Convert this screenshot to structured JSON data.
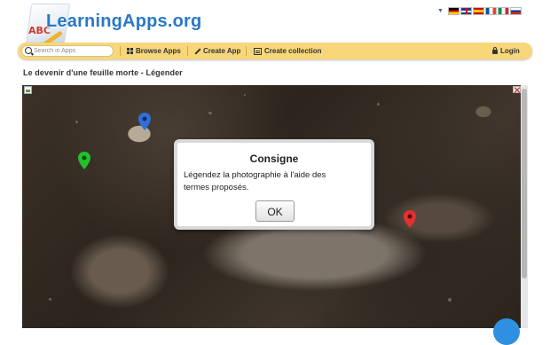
{
  "header": {
    "logo_text": "LearningApps.org",
    "logo_abc": "ABC",
    "languages": [
      "de",
      "en",
      "es",
      "fr",
      "it",
      "ru"
    ]
  },
  "navbar": {
    "search_placeholder": "Search in Apps",
    "browse_label": "Browse Apps",
    "create_label": "Create App",
    "collection_label": "Create collection",
    "login_label": "Login"
  },
  "page": {
    "title": "Le devenir d'une feuille morte - Légender"
  },
  "app": {
    "markers": [
      {
        "color": "#2f6fd6",
        "name": "blue"
      },
      {
        "color": "#22c12a",
        "name": "green"
      },
      {
        "color": "#e23030",
        "name": "red"
      }
    ]
  },
  "dialog": {
    "title": "Consigne",
    "text": "Légendez la photographie à l'aide des termes proposés.",
    "ok_label": "OK"
  }
}
